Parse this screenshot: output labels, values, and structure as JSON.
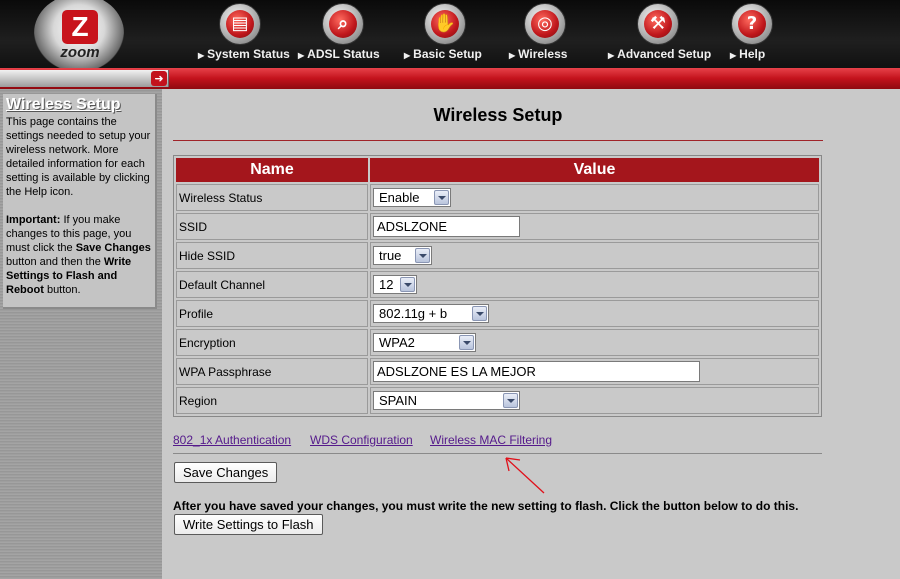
{
  "brand": {
    "logo_letter": "Z",
    "logo_text": "zoom"
  },
  "nav": [
    {
      "label": "System Status",
      "icon": "folder-icon",
      "glyph": "▤"
    },
    {
      "label": "ADSL Status",
      "icon": "magnifier-icon",
      "glyph": "⌕"
    },
    {
      "label": "Basic Setup",
      "icon": "hand-icon",
      "glyph": "✋"
    },
    {
      "label": "Wireless",
      "icon": "wireless-antenna-icon",
      "glyph": "◎"
    },
    {
      "label": "Advanced Setup",
      "icon": "wrench-icon",
      "glyph": "⚒"
    },
    {
      "label": "Help",
      "icon": "help-icon",
      "glyph": "?"
    }
  ],
  "sidebar": {
    "title": "Wireless Setup",
    "intro": "This page contains the settings needed to setup your wireless network. More detailed information for each setting is available by clicking the Help icon.",
    "important_label": "Important:",
    "important_text_1": " If you make changes to this page, you must click the ",
    "save_changes": "Save Changes",
    "important_text_2": " button and then the ",
    "write_settings": "Write Settings to Flash and Reboot",
    "important_text_3": " button."
  },
  "page": {
    "title": "Wireless Setup"
  },
  "table": {
    "headers": {
      "name": "Name",
      "value": "Value"
    },
    "rows": [
      {
        "name": "Wireless Status",
        "type": "select",
        "value": "Enable"
      },
      {
        "name": "SSID",
        "type": "text",
        "value": "ADSLZONE"
      },
      {
        "name": "Hide SSID",
        "type": "select",
        "value": "true"
      },
      {
        "name": "Default Channel",
        "type": "select",
        "value": "12"
      },
      {
        "name": "Profile",
        "type": "select",
        "value": "802.11g + b"
      },
      {
        "name": "Encryption",
        "type": "select",
        "value": "WPA2"
      },
      {
        "name": "WPA Passphrase",
        "type": "text",
        "value": "ADSLZONE ES LA MEJOR"
      },
      {
        "name": "Region",
        "type": "select",
        "value": "SPAIN"
      }
    ]
  },
  "links": {
    "auth": "802_1x Authentication",
    "wds": "WDS Configuration",
    "mac": "Wireless MAC Filtering"
  },
  "buttons": {
    "save": "Save Changes",
    "write": "Write Settings to Flash"
  },
  "note": "After you have saved your changes, you must write the new setting to flash. Click the button below to do this.",
  "colors": {
    "accent_red": "#a4161c",
    "annotation_red": "#e0101a",
    "link": "#551a8b"
  }
}
